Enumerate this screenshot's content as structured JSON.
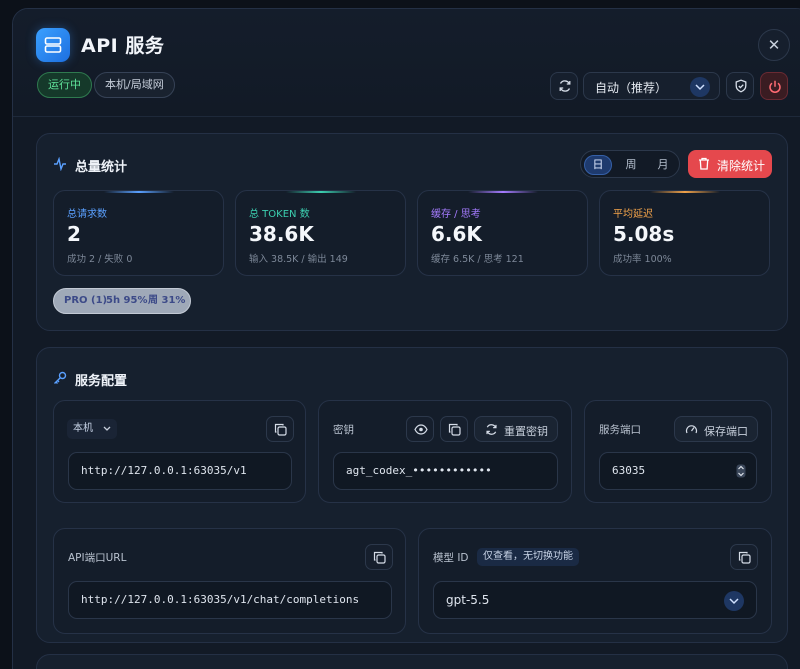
{
  "window": {
    "title": "API 服务"
  },
  "status": {
    "running": "运行中",
    "network": "本机/局域网"
  },
  "toolbar": {
    "mode_select": "自动（推荐）"
  },
  "stats": {
    "title": "总量统计",
    "periods": [
      "日",
      "周",
      "月"
    ],
    "active_period": "日",
    "clear_label": "清除统计",
    "cards": [
      {
        "label": "总请求数",
        "value": "2",
        "sub": "成功 2 / 失败 0",
        "color": "#5aa0ff"
      },
      {
        "label": "总 TOKEN 数",
        "value": "38.6K",
        "sub": "输入 38.5K / 输出 149",
        "color": "#3ccfb0"
      },
      {
        "label": "缓存 / 思考",
        "value": "6.6K",
        "sub": "缓存 6.5K / 思考 121",
        "color": "#a57bff"
      },
      {
        "label": "平均延迟",
        "value": "5.08s",
        "sub": "成功率 100%",
        "color": "#f0a24a"
      }
    ],
    "pro_badge": {
      "plan": "PRO (1)",
      "h5": "5h 95%",
      "week": "周 31%"
    }
  },
  "config": {
    "title": "服务配置",
    "host_select": "本机",
    "base_url": "http://127.0.0.1:63035/v1",
    "key_label": "密钥",
    "key_value": "agt_codex_••••••••••••",
    "reset_key_label": "重置密钥",
    "port_label": "服务端口",
    "save_port_label": "保存端口",
    "port_value": "63035",
    "endpoint_label": "API端口URL",
    "endpoint_value": "http://127.0.0.1:63035/v1/chat/completions",
    "model_label": "模型 ID",
    "model_tag": "仅查看，无切换功能",
    "model_value": "gpt-5.5"
  }
}
